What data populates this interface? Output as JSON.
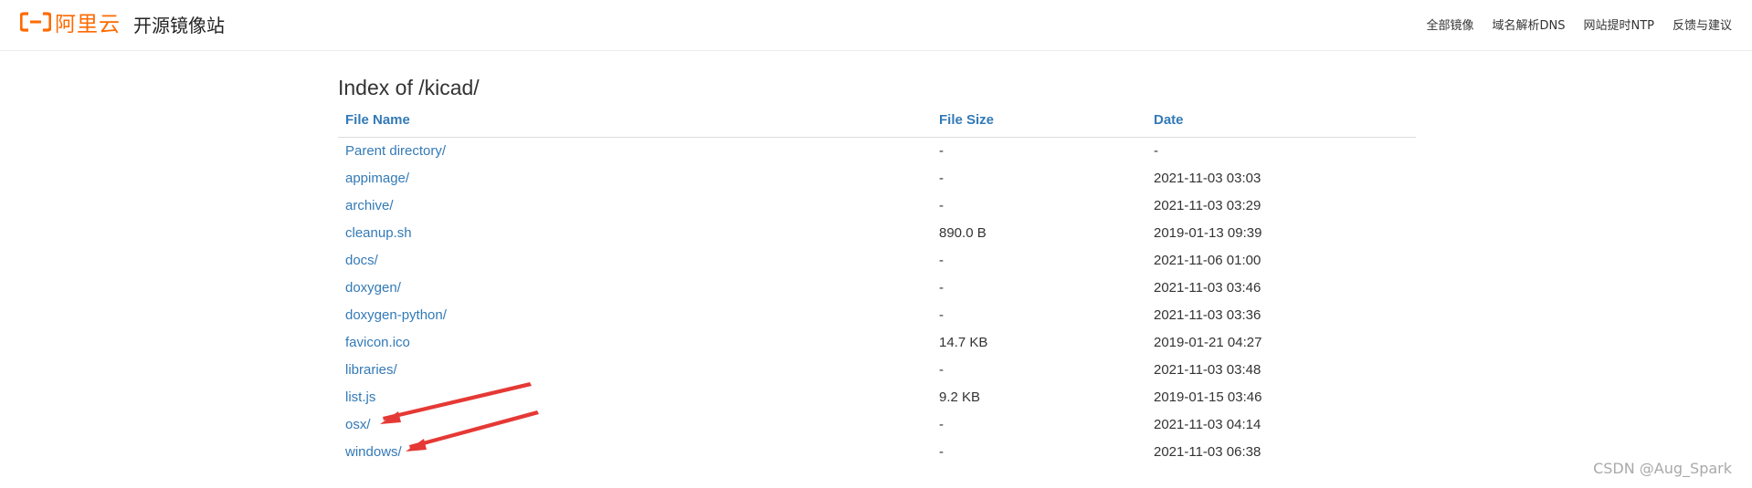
{
  "header": {
    "brand": "阿里云",
    "site_title": "开源镜像站",
    "nav": [
      "全部镜像",
      "域名解析DNS",
      "网站提时NTP",
      "反馈与建议"
    ]
  },
  "page": {
    "heading": "Index of /kicad/"
  },
  "table": {
    "columns": [
      "File Name",
      "File Size",
      "Date"
    ],
    "rows": [
      {
        "name": "Parent directory/",
        "size": "-",
        "date": "-"
      },
      {
        "name": "appimage/",
        "size": "-",
        "date": "2021-11-03 03:03"
      },
      {
        "name": "archive/",
        "size": "-",
        "date": "2021-11-03 03:29"
      },
      {
        "name": "cleanup.sh",
        "size": "890.0 B",
        "date": "2019-01-13 09:39"
      },
      {
        "name": "docs/",
        "size": "-",
        "date": "2021-11-06 01:00"
      },
      {
        "name": "doxygen/",
        "size": "-",
        "date": "2021-11-03 03:46"
      },
      {
        "name": "doxygen-python/",
        "size": "-",
        "date": "2021-11-03 03:36"
      },
      {
        "name": "favicon.ico",
        "size": "14.7 KB",
        "date": "2019-01-21 04:27"
      },
      {
        "name": "libraries/",
        "size": "-",
        "date": "2021-11-03 03:48"
      },
      {
        "name": "list.js",
        "size": "9.2 KB",
        "date": "2019-01-15 03:46"
      },
      {
        "name": "osx/",
        "size": "-",
        "date": "2021-11-03 04:14"
      },
      {
        "name": "windows/",
        "size": "-",
        "date": "2021-11-03 06:38"
      }
    ]
  },
  "annotations": {
    "arrow_color": "#e53935",
    "arrow_targets": [
      "osx/",
      "windows/"
    ]
  },
  "watermark": "CSDN @Aug_Spark",
  "colors": {
    "brand": "#ff6a00",
    "link": "#337ab7"
  }
}
